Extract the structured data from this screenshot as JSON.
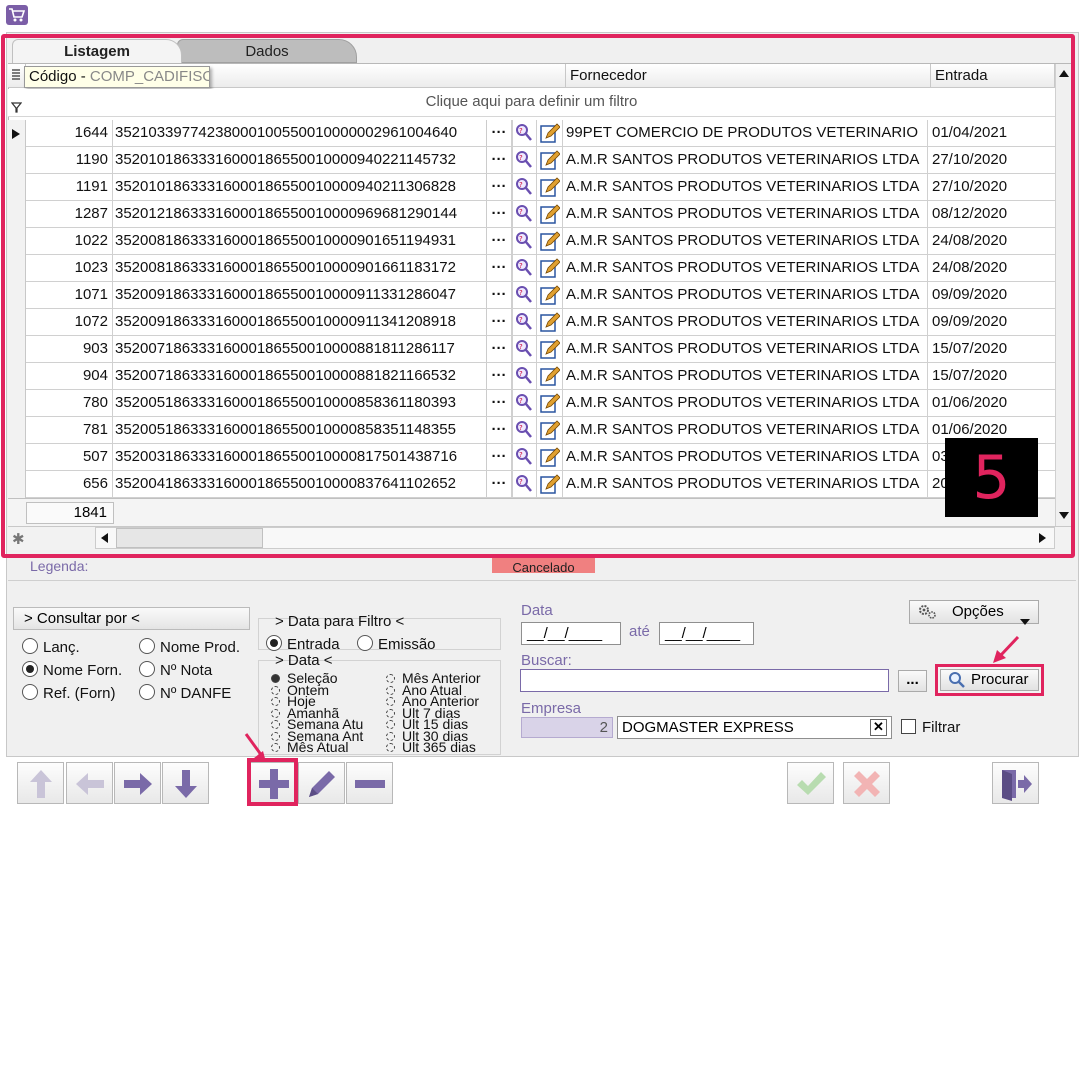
{
  "colors": {
    "accent": "#7b5ea7",
    "annotation": "#e0245e",
    "cancel_legend": "#f08080"
  },
  "tabs": [
    {
      "label": "Listagem",
      "active": true
    },
    {
      "label": "Dados",
      "active": false
    }
  ],
  "grid": {
    "columns": {
      "codigo": "Código",
      "fornecedor": "Fornecedor",
      "entrada": "Entrada"
    },
    "tooltip": {
      "text": "Código - ",
      "ghost": "COMP_CADIFISO"
    },
    "filter_hint": "Clique aqui para definir um filtro",
    "rows": [
      {
        "codigo": "1644",
        "chave": "35210339774238000100550010000002961004640",
        "fornecedor": "99PET COMERCIO DE PRODUTOS VETERINARIO",
        "entrada": "01/04/2021"
      },
      {
        "codigo": "1190",
        "chave": "35201018633316000186550010000940221145732",
        "fornecedor": "A.M.R SANTOS PRODUTOS VETERINARIOS LTDA",
        "entrada": "27/10/2020"
      },
      {
        "codigo": "1191",
        "chave": "35201018633316000186550010000940211306828",
        "fornecedor": "A.M.R SANTOS PRODUTOS VETERINARIOS LTDA",
        "entrada": "27/10/2020"
      },
      {
        "codigo": "1287",
        "chave": "35201218633316000186550010000969681290144",
        "fornecedor": "A.M.R SANTOS PRODUTOS VETERINARIOS LTDA",
        "entrada": "08/12/2020"
      },
      {
        "codigo": "1022",
        "chave": "35200818633316000186550010000901651194931",
        "fornecedor": "A.M.R SANTOS PRODUTOS VETERINARIOS LTDA",
        "entrada": "24/08/2020"
      },
      {
        "codigo": "1023",
        "chave": "35200818633316000186550010000901661183172",
        "fornecedor": "A.M.R SANTOS PRODUTOS VETERINARIOS LTDA",
        "entrada": "24/08/2020"
      },
      {
        "codigo": "1071",
        "chave": "35200918633316000186550010000911331286047",
        "fornecedor": "A.M.R SANTOS PRODUTOS VETERINARIOS LTDA",
        "entrada": "09/09/2020"
      },
      {
        "codigo": "1072",
        "chave": "35200918633316000186550010000911341208918",
        "fornecedor": "A.M.R SANTOS PRODUTOS VETERINARIOS LTDA",
        "entrada": "09/09/2020"
      },
      {
        "codigo": "903",
        "chave": "35200718633316000186550010000881811286117",
        "fornecedor": "A.M.R SANTOS PRODUTOS VETERINARIOS LTDA",
        "entrada": "15/07/2020"
      },
      {
        "codigo": "904",
        "chave": "35200718633316000186550010000881821166532",
        "fornecedor": "A.M.R SANTOS PRODUTOS VETERINARIOS LTDA",
        "entrada": "15/07/2020"
      },
      {
        "codigo": "780",
        "chave": "35200518633316000186550010000858361180393",
        "fornecedor": "A.M.R SANTOS PRODUTOS VETERINARIOS LTDA",
        "entrada": "01/06/2020"
      },
      {
        "codigo": "781",
        "chave": "35200518633316000186550010000858351148355",
        "fornecedor": "A.M.R SANTOS PRODUTOS VETERINARIOS LTDA",
        "entrada": "01/06/2020"
      },
      {
        "codigo": "507",
        "chave": "35200318633316000186550010000817501438716",
        "fornecedor": "A.M.R SANTOS PRODUTOS VETERINARIOS LTDA",
        "entrada": "03"
      },
      {
        "codigo": "656",
        "chave": "35200418633316000186550010000837641102652",
        "fornecedor": "A.M.R SANTOS PRODUTOS VETERINARIOS LTDA",
        "entrada": "20"
      }
    ],
    "ellipsis": "···",
    "total": "1841"
  },
  "annotation_step": "5",
  "legend": {
    "label": "Legenda:",
    "cancelado": "Cancelado"
  },
  "consultar": {
    "button": "> Consultar por <",
    "options": [
      {
        "label": "Lanç.",
        "selected": false
      },
      {
        "label": "Nome Prod.",
        "selected": false
      },
      {
        "label": "Nome Forn.",
        "selected": true
      },
      {
        "label": "Nº Nota",
        "selected": false
      },
      {
        "label": "Ref. (Forn)",
        "selected": false
      },
      {
        "label": "Nº DANFE",
        "selected": false
      }
    ]
  },
  "data_filtro": {
    "title": "> Data para Filtro <",
    "options": [
      {
        "label": "Entrada",
        "selected": true
      },
      {
        "label": "Emissão",
        "selected": false
      }
    ]
  },
  "data_group": {
    "title": "> Data <",
    "left": [
      "Seleção",
      "Ontem",
      "Hoje",
      "Amanhã",
      "Semana Atu",
      "Semana Ant",
      "Mês Atual"
    ],
    "right": [
      "Mês Anterior",
      "Ano Atual",
      "Ano Anterior",
      "Ult 7 dias",
      "Ult 15 dias",
      "Ult 30 dias",
      "Ult 365 dias"
    ]
  },
  "search": {
    "data_label": "Data",
    "date_from": "__/__/____",
    "ate_label": "até",
    "date_to": "__/__/____",
    "buscar_label": "Buscar:",
    "buscar_value": "",
    "dots": "...",
    "procurar": "Procurar",
    "opcoes": "Opções",
    "empresa_label": "Empresa",
    "empresa_num": "2",
    "empresa_name": "DOGMASTER EXPRESS",
    "filtrar": "Filtrar"
  },
  "icons": {
    "cart": "cart-icon",
    "up": "arrow-up-icon",
    "left": "arrow-left-icon",
    "right": "arrow-right-icon",
    "down": "arrow-down-icon",
    "add": "plus-icon",
    "edit": "pencil-icon",
    "remove": "minus-icon",
    "confirm": "check-icon",
    "cancel": "x-icon",
    "exit": "exit-icon"
  }
}
